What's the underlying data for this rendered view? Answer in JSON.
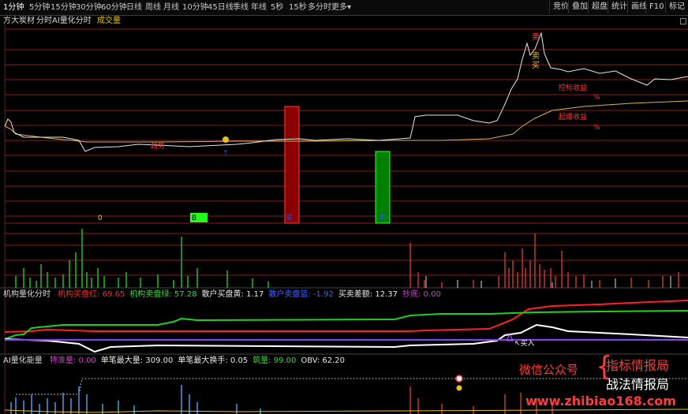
{
  "toolbar": {
    "periods": [
      "1分钟",
      "5分钟",
      "15分钟",
      "30分钟",
      "60分钟",
      "日线",
      "周线",
      "月线",
      "10分钟",
      "45日线",
      "季线",
      "年线",
      "5秒",
      "15秒",
      "多分时",
      "更多"
    ],
    "more_arrow": "▾",
    "right_buttons": [
      "竞价",
      "叠加",
      "超盘",
      "统计",
      "画线",
      "F10",
      "标记"
    ]
  },
  "main_panel": {
    "stock_name": "方大炭材",
    "mode": "分时",
    "indicator": "AI量化分时",
    "volume_label": "成交量",
    "annotations": {
      "sell1": "卖",
      "sell2": "卖",
      "buy_label": "买",
      "control_label": "控标收益",
      "control_pct": "%",
      "start_label": "起爆收益",
      "start_pct": "%",
      "trend_label": "趋势",
      "zero_label": "0",
      "green_box_label": "B",
      "red_bar_label": "买",
      "green_bar_label": "卖"
    }
  },
  "indicator_panel1": {
    "title": "机构量化分时",
    "items": [
      {
        "label": "机构买盘红:",
        "value": "69.65",
        "color": "#ff2a2a"
      },
      {
        "label": "机构卖盘绿:",
        "value": "57.28",
        "color": "#2ee02e"
      },
      {
        "label": "散户买盘黄:",
        "value": "1.17",
        "color": "#e8e8e8"
      },
      {
        "label": "散户卖盘蓝:",
        "value": "-1.92",
        "color": "#4060ff"
      },
      {
        "label": "买卖差额:",
        "value": "12.37",
        "color": "#e8e8e8"
      },
      {
        "label": "抄底:",
        "value": "0.00",
        "color": "#d040d0"
      }
    ],
    "buy_marker": "买入"
  },
  "indicator_panel2": {
    "title": "AI量化能量",
    "items": [
      {
        "label": "特准量:",
        "value": "0.00",
        "color": "#d040d0"
      },
      {
        "label": "单笔最大量:",
        "value": "309.00",
        "color": "#e8e8e8"
      },
      {
        "label": "单笔最大换手:",
        "value": "0.05",
        "color": "#e8e8e8"
      },
      {
        "label": "筑量:",
        "value": "99.00",
        "color": "#2ee02e"
      },
      {
        "label": "OBV:",
        "value": "62.20",
        "color": "#e8e8e8"
      }
    ]
  },
  "watermark": {
    "wechat": "微信公众号",
    "line1": "指标情报局",
    "line2": "战法情报局",
    "url": "www.zhibiao168.com"
  },
  "colors": {
    "grid_red": "#8b1a1a",
    "price_line": "#e6e6e6",
    "avg_line": "#d4b84a",
    "bar_red": "#8b0000",
    "bar_green": "#008000",
    "vol_green": "#1fbf1f",
    "vol_red": "#c83232",
    "line_red": "#ff2020",
    "line_green": "#20d020",
    "line_white": "#ffffff",
    "line_purple": "#8a3cff"
  }
}
